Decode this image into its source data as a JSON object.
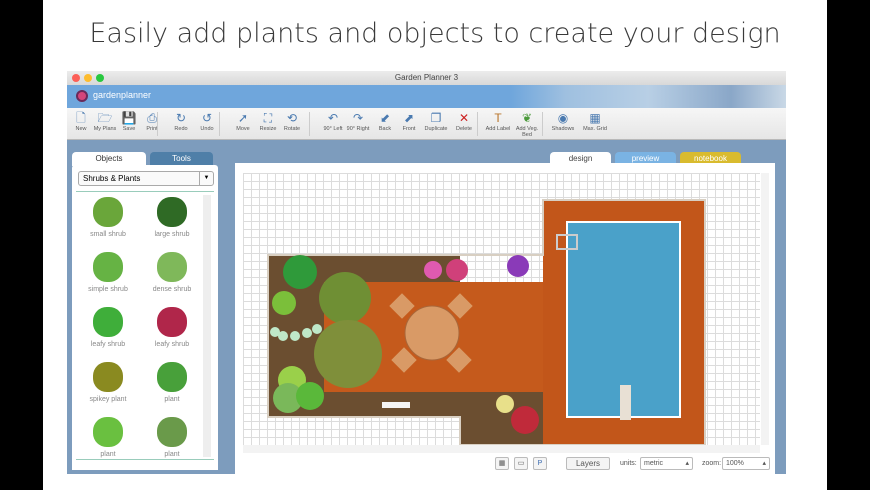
{
  "headline": "Easily add plants and objects to create your design",
  "window": {
    "title": "Garden Planner 3",
    "brand": "gardenplanner"
  },
  "toolbar": [
    {
      "label": "New",
      "icon": "new-document-icon",
      "glyph": "🗋"
    },
    {
      "label": "My Plans",
      "icon": "folder-icon",
      "glyph": "🗁"
    },
    {
      "label": "Save",
      "icon": "save-icon",
      "glyph": "💾"
    },
    {
      "label": "Print",
      "icon": "print-icon",
      "glyph": "⎙"
    },
    {
      "label": "Redo",
      "icon": "redo-icon",
      "glyph": "↻"
    },
    {
      "label": "Undo",
      "icon": "undo-icon",
      "glyph": "↺"
    },
    {
      "label": "Move",
      "icon": "move-icon",
      "glyph": "➚"
    },
    {
      "label": "Resize",
      "icon": "resize-icon",
      "glyph": "⛶"
    },
    {
      "label": "Rotate",
      "icon": "rotate-icon",
      "glyph": "⟲"
    },
    {
      "label": "90° Left",
      "icon": "rotate-left-icon",
      "glyph": "↶"
    },
    {
      "label": "90° Right",
      "icon": "rotate-right-icon",
      "glyph": "↷"
    },
    {
      "label": "Back",
      "icon": "send-back-icon",
      "glyph": "⬋"
    },
    {
      "label": "Front",
      "icon": "bring-front-icon",
      "glyph": "⬈"
    },
    {
      "label": "Duplicate",
      "icon": "duplicate-icon",
      "glyph": "❐"
    },
    {
      "label": "Delete",
      "icon": "delete-icon",
      "glyph": "✕"
    },
    {
      "label": "Add Label",
      "icon": "label-icon",
      "glyph": "T"
    },
    {
      "label": "Add Veg. Bed",
      "icon": "veg-bed-icon",
      "glyph": "❦"
    },
    {
      "label": "Shadows",
      "icon": "shadows-icon",
      "glyph": "◉"
    },
    {
      "label": "Max. Grid",
      "icon": "max-grid-icon",
      "glyph": "▦"
    }
  ],
  "panel": {
    "tabs": [
      "Objects",
      "Tools"
    ],
    "category": "Shrubs & Plants",
    "items": [
      {
        "label": "small shrub",
        "color": "#6aa63a"
      },
      {
        "label": "large shrub",
        "color": "#2f6a25"
      },
      {
        "label": "simple shrub",
        "color": "#66b344"
      },
      {
        "label": "dense shrub",
        "color": "#7fb85a"
      },
      {
        "label": "leafy shrub",
        "color": "#3fae3a"
      },
      {
        "label": "leafy shrub",
        "color": "#b0264a"
      },
      {
        "label": "spikey plant",
        "color": "#8a8a20"
      },
      {
        "label": "plant",
        "color": "#48a03a"
      },
      {
        "label": "plant",
        "color": "#6ac040"
      },
      {
        "label": "plant",
        "color": "#6a9a4a"
      }
    ]
  },
  "canvas_tabs": [
    {
      "label": "design",
      "color": "#ffffff",
      "text": "#444"
    },
    {
      "label": "preview",
      "color": "#7ab3e3",
      "text": "#fff"
    },
    {
      "label": "notebook",
      "color": "#d9bb2e",
      "text": "#fff"
    }
  ],
  "bottom": {
    "layers": "Layers",
    "units_label": "units:",
    "units": "metric",
    "zoom_label": "zoom:",
    "zoom": "100%"
  }
}
